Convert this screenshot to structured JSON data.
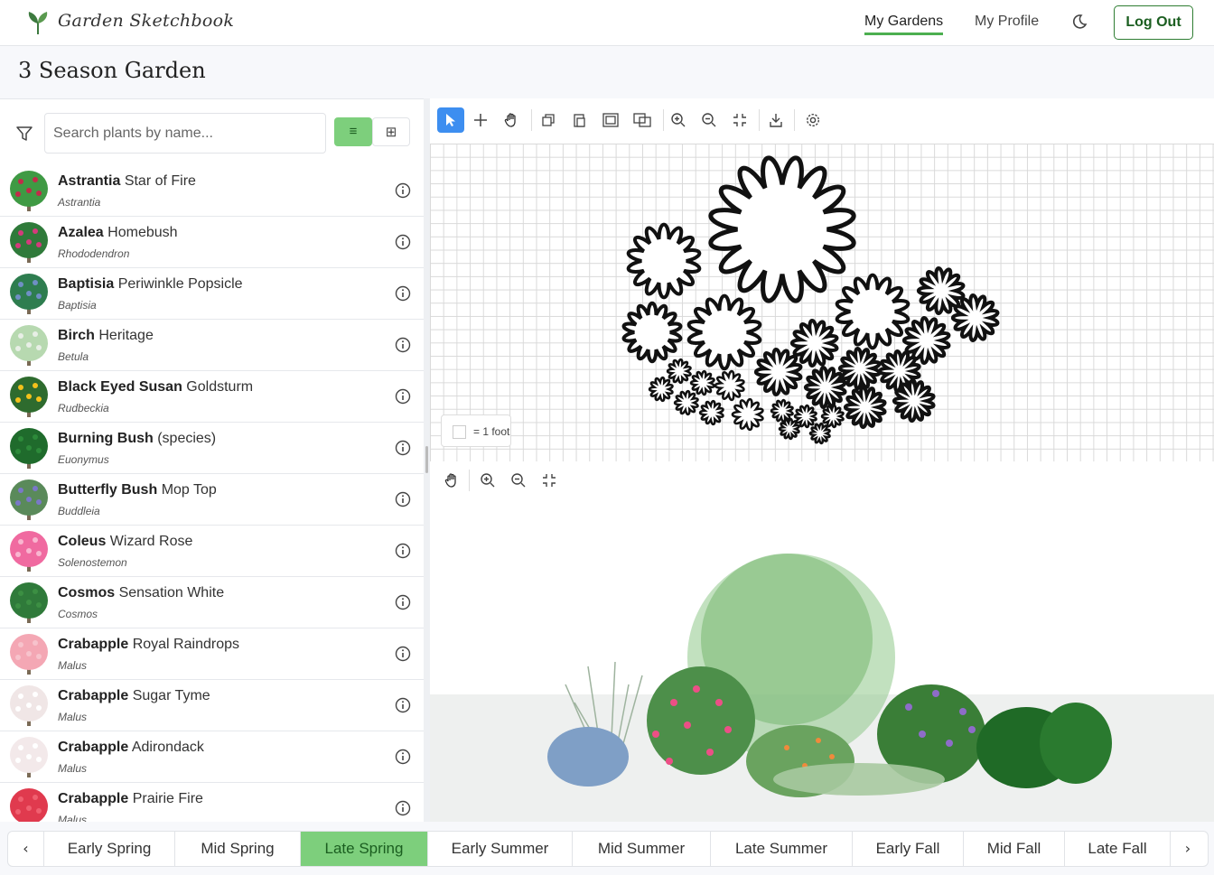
{
  "header": {
    "app_title": "Garden Sketchbook",
    "nav": [
      {
        "label": "My Gardens",
        "active": true
      },
      {
        "label": "My Profile",
        "active": false
      }
    ],
    "logout_label": "Log Out",
    "brand_color": "#2e7d32"
  },
  "page": {
    "title": "3 Season Garden"
  },
  "sidebar": {
    "search_placeholder": "Search plants by name...",
    "list_view_icon": "≡",
    "grid_view_icon": "⊞",
    "plants": [
      {
        "genus_common": "Astrantia",
        "variety": "Star of Fire",
        "genus": "Astrantia",
        "color": "#3f9a44",
        "flower": "#c22b4a"
      },
      {
        "genus_common": "Azalea",
        "variety": "Homebush",
        "genus": "Rhododendron",
        "color": "#2f7a3a",
        "flower": "#d43a7c"
      },
      {
        "genus_common": "Baptisia",
        "variety": "Periwinkle Popsicle",
        "genus": "Baptisia",
        "color": "#2e7d4f",
        "flower": "#6f8fc4"
      },
      {
        "genus_common": "Birch",
        "variety": "Heritage",
        "genus": "Betula",
        "color": "#b7d9b0",
        "flower": "#e8efe6"
      },
      {
        "genus_common": "Black Eyed Susan",
        "variety": "Goldsturm",
        "genus": "Rudbeckia",
        "color": "#2e6b2e",
        "flower": "#f3c11b"
      },
      {
        "genus_common": "Burning Bush",
        "variety": "(species)",
        "genus": "Euonymus",
        "color": "#1f6b2c",
        "flower": "#2d8a3a"
      },
      {
        "genus_common": "Butterfly Bush",
        "variety": "Mop Top",
        "genus": "Buddleia",
        "color": "#5a8a5a",
        "flower": "#7a78c8"
      },
      {
        "genus_common": "Coleus",
        "variety": "Wizard Rose",
        "genus": "Solenostemon",
        "color": "#f06aa0",
        "flower": "#f9b6d0"
      },
      {
        "genus_common": "Cosmos",
        "variety": "Sensation White",
        "genus": "Cosmos",
        "color": "#2f7a3a",
        "flower": "#3c8f43"
      },
      {
        "genus_common": "Crabapple",
        "variety": "Royal Raindrops",
        "genus": "Malus",
        "color": "#f4a7b4",
        "flower": "#f7c3cc"
      },
      {
        "genus_common": "Crabapple",
        "variety": "Sugar Tyme",
        "genus": "Malus",
        "color": "#f0e6e6",
        "flower": "#ffffff"
      },
      {
        "genus_common": "Crabapple",
        "variety": "Adirondack",
        "genus": "Malus",
        "color": "#f3e9ea",
        "flower": "#ffffff"
      },
      {
        "genus_common": "Crabapple",
        "variety": "Prairie Fire",
        "genus": "Malus",
        "color": "#e03a4e",
        "flower": "#f06070"
      }
    ]
  },
  "canvas": {
    "scale_label": "= 1 foot"
  },
  "seasons": {
    "prev_label": "‹",
    "next_label": "›",
    "tabs": [
      {
        "label": "Early Spring",
        "active": false
      },
      {
        "label": "Mid Spring",
        "active": false
      },
      {
        "label": "Late Spring",
        "active": true
      },
      {
        "label": "Early Summer",
        "active": false
      },
      {
        "label": "Mid Summer",
        "active": false
      },
      {
        "label": "Late Summer",
        "active": false
      },
      {
        "label": "Early Fall",
        "active": false
      },
      {
        "label": "Mid Fall",
        "active": false
      },
      {
        "label": "Late Fall",
        "active": false
      }
    ]
  }
}
